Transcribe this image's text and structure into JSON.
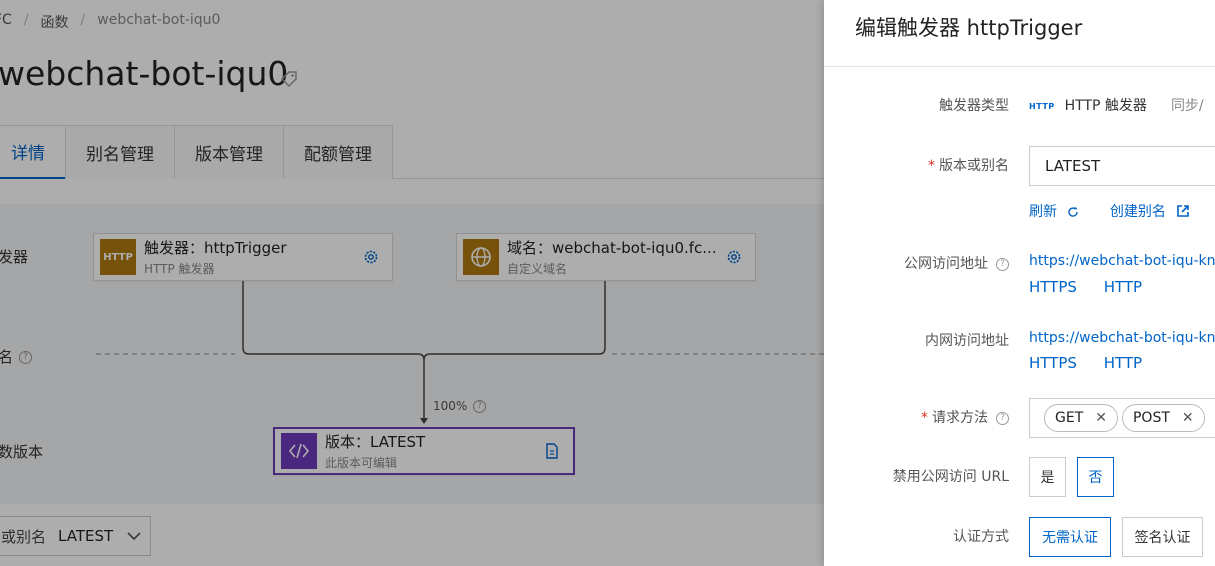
{
  "breadcrumb": {
    "item1": "FC",
    "item2": "函数",
    "item3": "webchat-bot-iqu0"
  },
  "page": {
    "title": "webchat-bot-iqu0",
    "tag_icon": "tag-icon"
  },
  "tabs": [
    {
      "label": "详情"
    },
    {
      "label": "别名管理"
    },
    {
      "label": "版本管理"
    },
    {
      "label": "配额管理"
    }
  ],
  "diagram": {
    "row_trigger": "发器",
    "row_alias": "名",
    "row_version": "数版本",
    "trigger_node": {
      "icon_text": "HTTP",
      "title": "触发器：httpTrigger",
      "subtitle": "HTTP 触发器"
    },
    "domain_node": {
      "title": "域名：webchat-bot-iqu0.fc...",
      "subtitle": "自定义域名"
    },
    "version_node": {
      "title": "版本：LATEST",
      "subtitle": "此版本可编辑"
    },
    "percent": "100%"
  },
  "bottom": {
    "label": "或别名",
    "value": "LATEST"
  },
  "drawer": {
    "title": "编辑触发器 httpTrigger",
    "trigger_type_label": "触发器类型",
    "trigger_type_badge": "HTTP",
    "trigger_type_value": "HTTP 触发器",
    "trigger_type_extra": "同步/",
    "version_label": "版本或别名",
    "version_value": "LATEST",
    "refresh_label": "刷新",
    "create_alias_label": "创建别名",
    "public_url_label": "公网访问地址",
    "public_url": "https://webchat-bot-iqu-knzh",
    "internal_url_label": "内网访问地址",
    "internal_url": "https://webchat-bot-iqu-knzh",
    "https_label": "HTTPS",
    "http_label": "HTTP",
    "method_label": "请求方法",
    "methods": [
      "GET",
      "POST"
    ],
    "disable_public_label": "禁用公网访问 URL",
    "yes_label": "是",
    "no_label": "否",
    "auth_label": "认证方式",
    "auth_none": "无需认证",
    "auth_sign": "签名认证"
  },
  "colors": {
    "accent": "#0064c8",
    "required": "#d93026",
    "trigger_icon_bg": "#b07a10",
    "version_icon_bg": "#6e3bbd",
    "version_border": "#6e3bbd"
  }
}
